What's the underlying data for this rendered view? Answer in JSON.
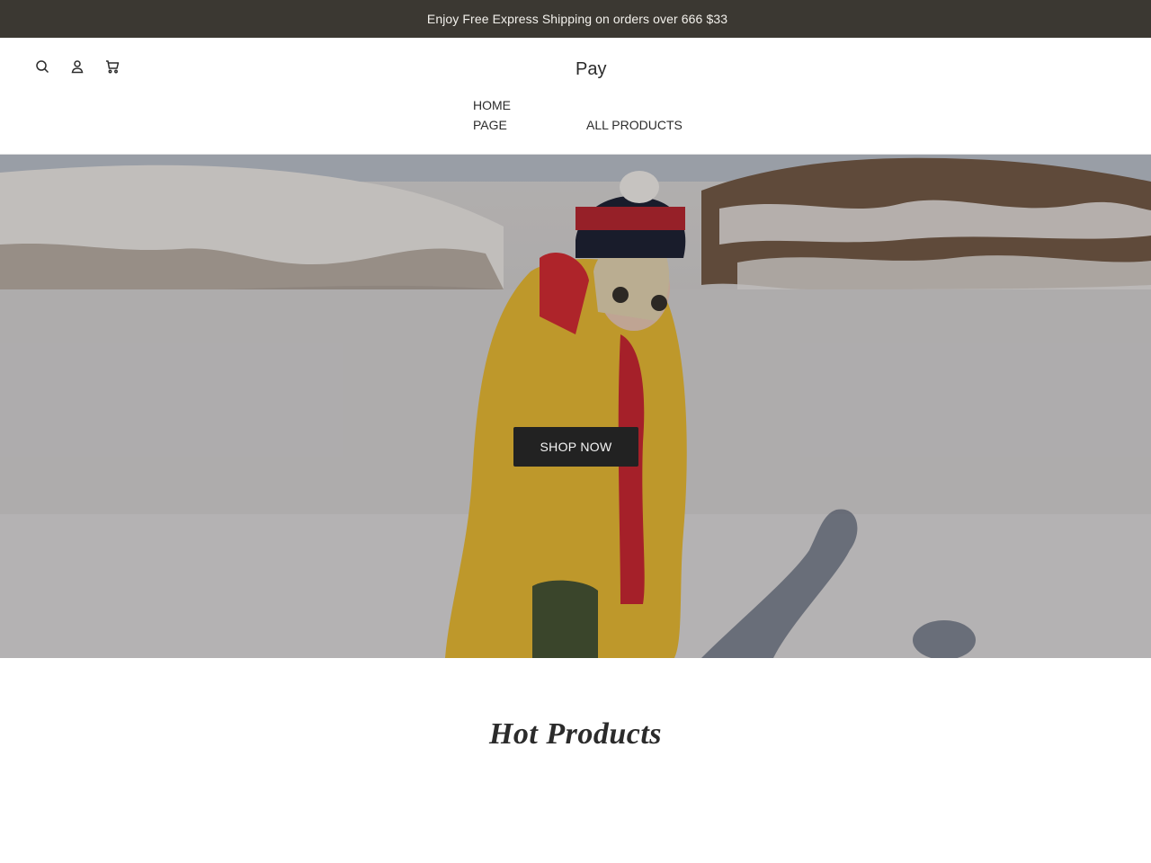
{
  "announcement": {
    "text": "Enjoy Free Express Shipping on orders over 666",
    "amount": "$33"
  },
  "header": {
    "logo": "Pay",
    "icons": [
      "search-icon",
      "account-icon",
      "cart-icon"
    ],
    "nav": {
      "home": "HOME PAGE",
      "all_products": "ALL PRODUCTS"
    }
  },
  "hero": {
    "cta_label": "SHOP NOW"
  },
  "hot_products": {
    "title": "Hot Products"
  },
  "colors": {
    "announcement_bg": "#3b3832",
    "button_bg": "#222222",
    "text": "#2b2b2b"
  }
}
